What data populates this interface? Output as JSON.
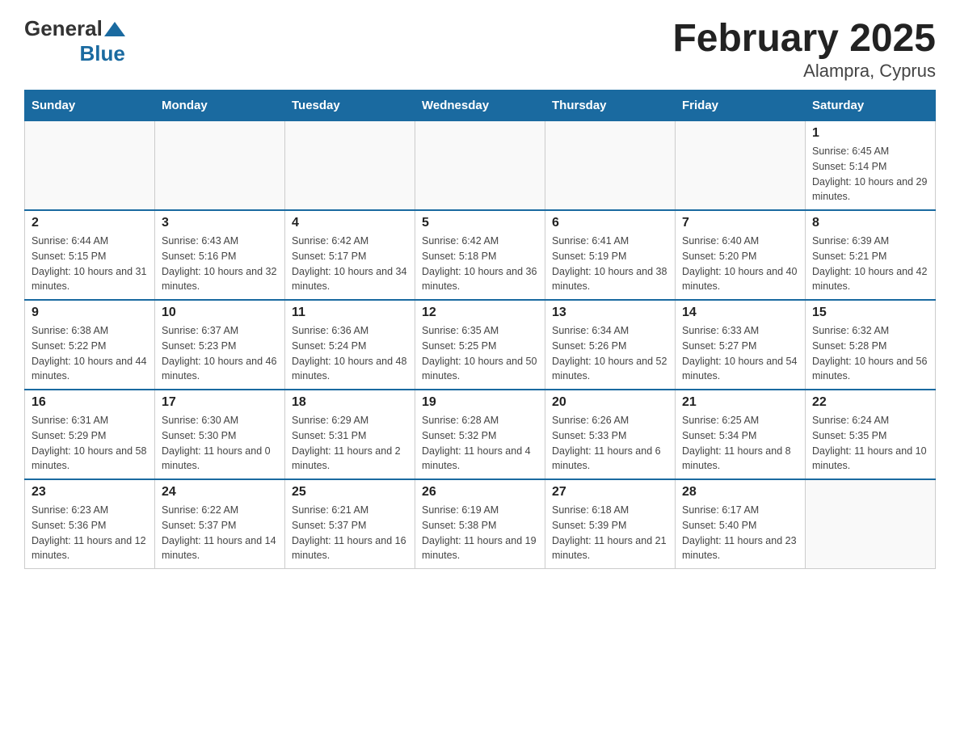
{
  "logo": {
    "general": "General",
    "blue": "Blue"
  },
  "title": "February 2025",
  "location": "Alampra, Cyprus",
  "headers": [
    "Sunday",
    "Monday",
    "Tuesday",
    "Wednesday",
    "Thursday",
    "Friday",
    "Saturday"
  ],
  "weeks": [
    [
      {
        "day": "",
        "info": ""
      },
      {
        "day": "",
        "info": ""
      },
      {
        "day": "",
        "info": ""
      },
      {
        "day": "",
        "info": ""
      },
      {
        "day": "",
        "info": ""
      },
      {
        "day": "",
        "info": ""
      },
      {
        "day": "1",
        "info": "Sunrise: 6:45 AM\nSunset: 5:14 PM\nDaylight: 10 hours and 29 minutes."
      }
    ],
    [
      {
        "day": "2",
        "info": "Sunrise: 6:44 AM\nSunset: 5:15 PM\nDaylight: 10 hours and 31 minutes."
      },
      {
        "day": "3",
        "info": "Sunrise: 6:43 AM\nSunset: 5:16 PM\nDaylight: 10 hours and 32 minutes."
      },
      {
        "day": "4",
        "info": "Sunrise: 6:42 AM\nSunset: 5:17 PM\nDaylight: 10 hours and 34 minutes."
      },
      {
        "day": "5",
        "info": "Sunrise: 6:42 AM\nSunset: 5:18 PM\nDaylight: 10 hours and 36 minutes."
      },
      {
        "day": "6",
        "info": "Sunrise: 6:41 AM\nSunset: 5:19 PM\nDaylight: 10 hours and 38 minutes."
      },
      {
        "day": "7",
        "info": "Sunrise: 6:40 AM\nSunset: 5:20 PM\nDaylight: 10 hours and 40 minutes."
      },
      {
        "day": "8",
        "info": "Sunrise: 6:39 AM\nSunset: 5:21 PM\nDaylight: 10 hours and 42 minutes."
      }
    ],
    [
      {
        "day": "9",
        "info": "Sunrise: 6:38 AM\nSunset: 5:22 PM\nDaylight: 10 hours and 44 minutes."
      },
      {
        "day": "10",
        "info": "Sunrise: 6:37 AM\nSunset: 5:23 PM\nDaylight: 10 hours and 46 minutes."
      },
      {
        "day": "11",
        "info": "Sunrise: 6:36 AM\nSunset: 5:24 PM\nDaylight: 10 hours and 48 minutes."
      },
      {
        "day": "12",
        "info": "Sunrise: 6:35 AM\nSunset: 5:25 PM\nDaylight: 10 hours and 50 minutes."
      },
      {
        "day": "13",
        "info": "Sunrise: 6:34 AM\nSunset: 5:26 PM\nDaylight: 10 hours and 52 minutes."
      },
      {
        "day": "14",
        "info": "Sunrise: 6:33 AM\nSunset: 5:27 PM\nDaylight: 10 hours and 54 minutes."
      },
      {
        "day": "15",
        "info": "Sunrise: 6:32 AM\nSunset: 5:28 PM\nDaylight: 10 hours and 56 minutes."
      }
    ],
    [
      {
        "day": "16",
        "info": "Sunrise: 6:31 AM\nSunset: 5:29 PM\nDaylight: 10 hours and 58 minutes."
      },
      {
        "day": "17",
        "info": "Sunrise: 6:30 AM\nSunset: 5:30 PM\nDaylight: 11 hours and 0 minutes."
      },
      {
        "day": "18",
        "info": "Sunrise: 6:29 AM\nSunset: 5:31 PM\nDaylight: 11 hours and 2 minutes."
      },
      {
        "day": "19",
        "info": "Sunrise: 6:28 AM\nSunset: 5:32 PM\nDaylight: 11 hours and 4 minutes."
      },
      {
        "day": "20",
        "info": "Sunrise: 6:26 AM\nSunset: 5:33 PM\nDaylight: 11 hours and 6 minutes."
      },
      {
        "day": "21",
        "info": "Sunrise: 6:25 AM\nSunset: 5:34 PM\nDaylight: 11 hours and 8 minutes."
      },
      {
        "day": "22",
        "info": "Sunrise: 6:24 AM\nSunset: 5:35 PM\nDaylight: 11 hours and 10 minutes."
      }
    ],
    [
      {
        "day": "23",
        "info": "Sunrise: 6:23 AM\nSunset: 5:36 PM\nDaylight: 11 hours and 12 minutes."
      },
      {
        "day": "24",
        "info": "Sunrise: 6:22 AM\nSunset: 5:37 PM\nDaylight: 11 hours and 14 minutes."
      },
      {
        "day": "25",
        "info": "Sunrise: 6:21 AM\nSunset: 5:37 PM\nDaylight: 11 hours and 16 minutes."
      },
      {
        "day": "26",
        "info": "Sunrise: 6:19 AM\nSunset: 5:38 PM\nDaylight: 11 hours and 19 minutes."
      },
      {
        "day": "27",
        "info": "Sunrise: 6:18 AM\nSunset: 5:39 PM\nDaylight: 11 hours and 21 minutes."
      },
      {
        "day": "28",
        "info": "Sunrise: 6:17 AM\nSunset: 5:40 PM\nDaylight: 11 hours and 23 minutes."
      },
      {
        "day": "",
        "info": ""
      }
    ]
  ]
}
